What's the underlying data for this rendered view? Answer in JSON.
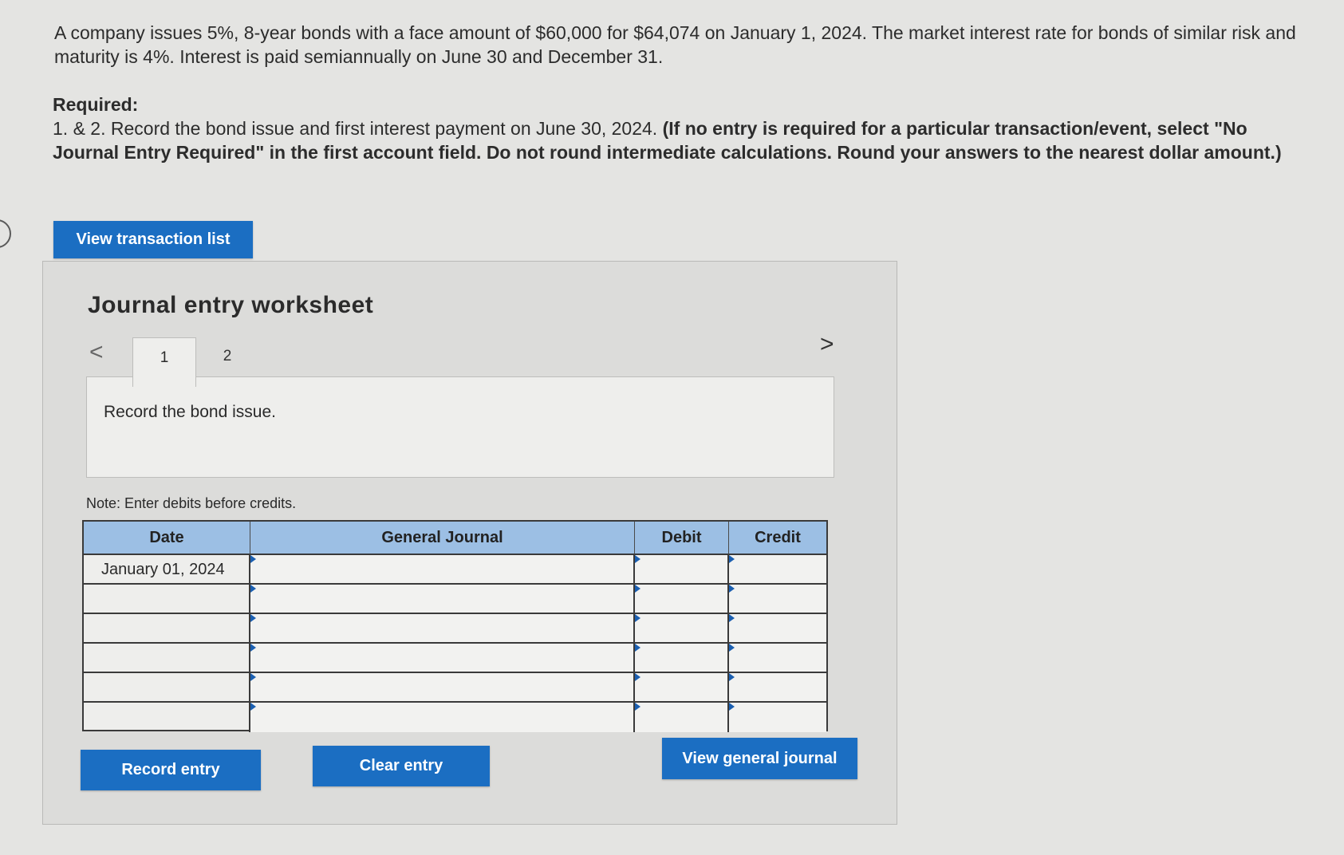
{
  "problem": {
    "intro": "A company issues 5%, 8-year bonds with a face amount of $60,000 for $64,074 on January 1, 2024. The market interest rate for bonds of similar risk and maturity is 4%. Interest is paid semiannually on June 30 and December 31.",
    "required_heading": "Required:",
    "required_plain": "1. & 2. Record the bond issue and first interest payment on June 30, 2024.",
    "required_bold": "(If no entry is required for a particular transaction/event, select \"No Journal Entry Required\" in the first account field. Do not round intermediate calculations. Round your answers to the nearest dollar amount.)"
  },
  "buttons": {
    "view_transaction_list": "View transaction list",
    "record_entry": "Record entry",
    "clear_entry": "Clear entry",
    "view_general_journal": "View general journal"
  },
  "worksheet": {
    "title": "Journal entry worksheet",
    "nav_prev": "<",
    "nav_next": ">",
    "tabs": [
      "1",
      "2"
    ],
    "active_tab": "1",
    "description": "Record the bond issue.",
    "note": "Note: Enter debits before credits."
  },
  "journal": {
    "headers": {
      "date": "Date",
      "general_journal": "General Journal",
      "debit": "Debit",
      "credit": "Credit"
    },
    "rows": [
      {
        "date": "January 01, 2024",
        "account": "",
        "debit": "",
        "credit": ""
      },
      {
        "date": "",
        "account": "",
        "debit": "",
        "credit": ""
      },
      {
        "date": "",
        "account": "",
        "debit": "",
        "credit": ""
      },
      {
        "date": "",
        "account": "",
        "debit": "",
        "credit": ""
      },
      {
        "date": "",
        "account": "",
        "debit": "",
        "credit": ""
      },
      {
        "date": "",
        "account": "",
        "debit": "",
        "credit": ""
      }
    ]
  },
  "colors": {
    "button_blue": "#1b6ec2",
    "header_blue": "#9cbfe4",
    "background": "#e4e4e2"
  }
}
